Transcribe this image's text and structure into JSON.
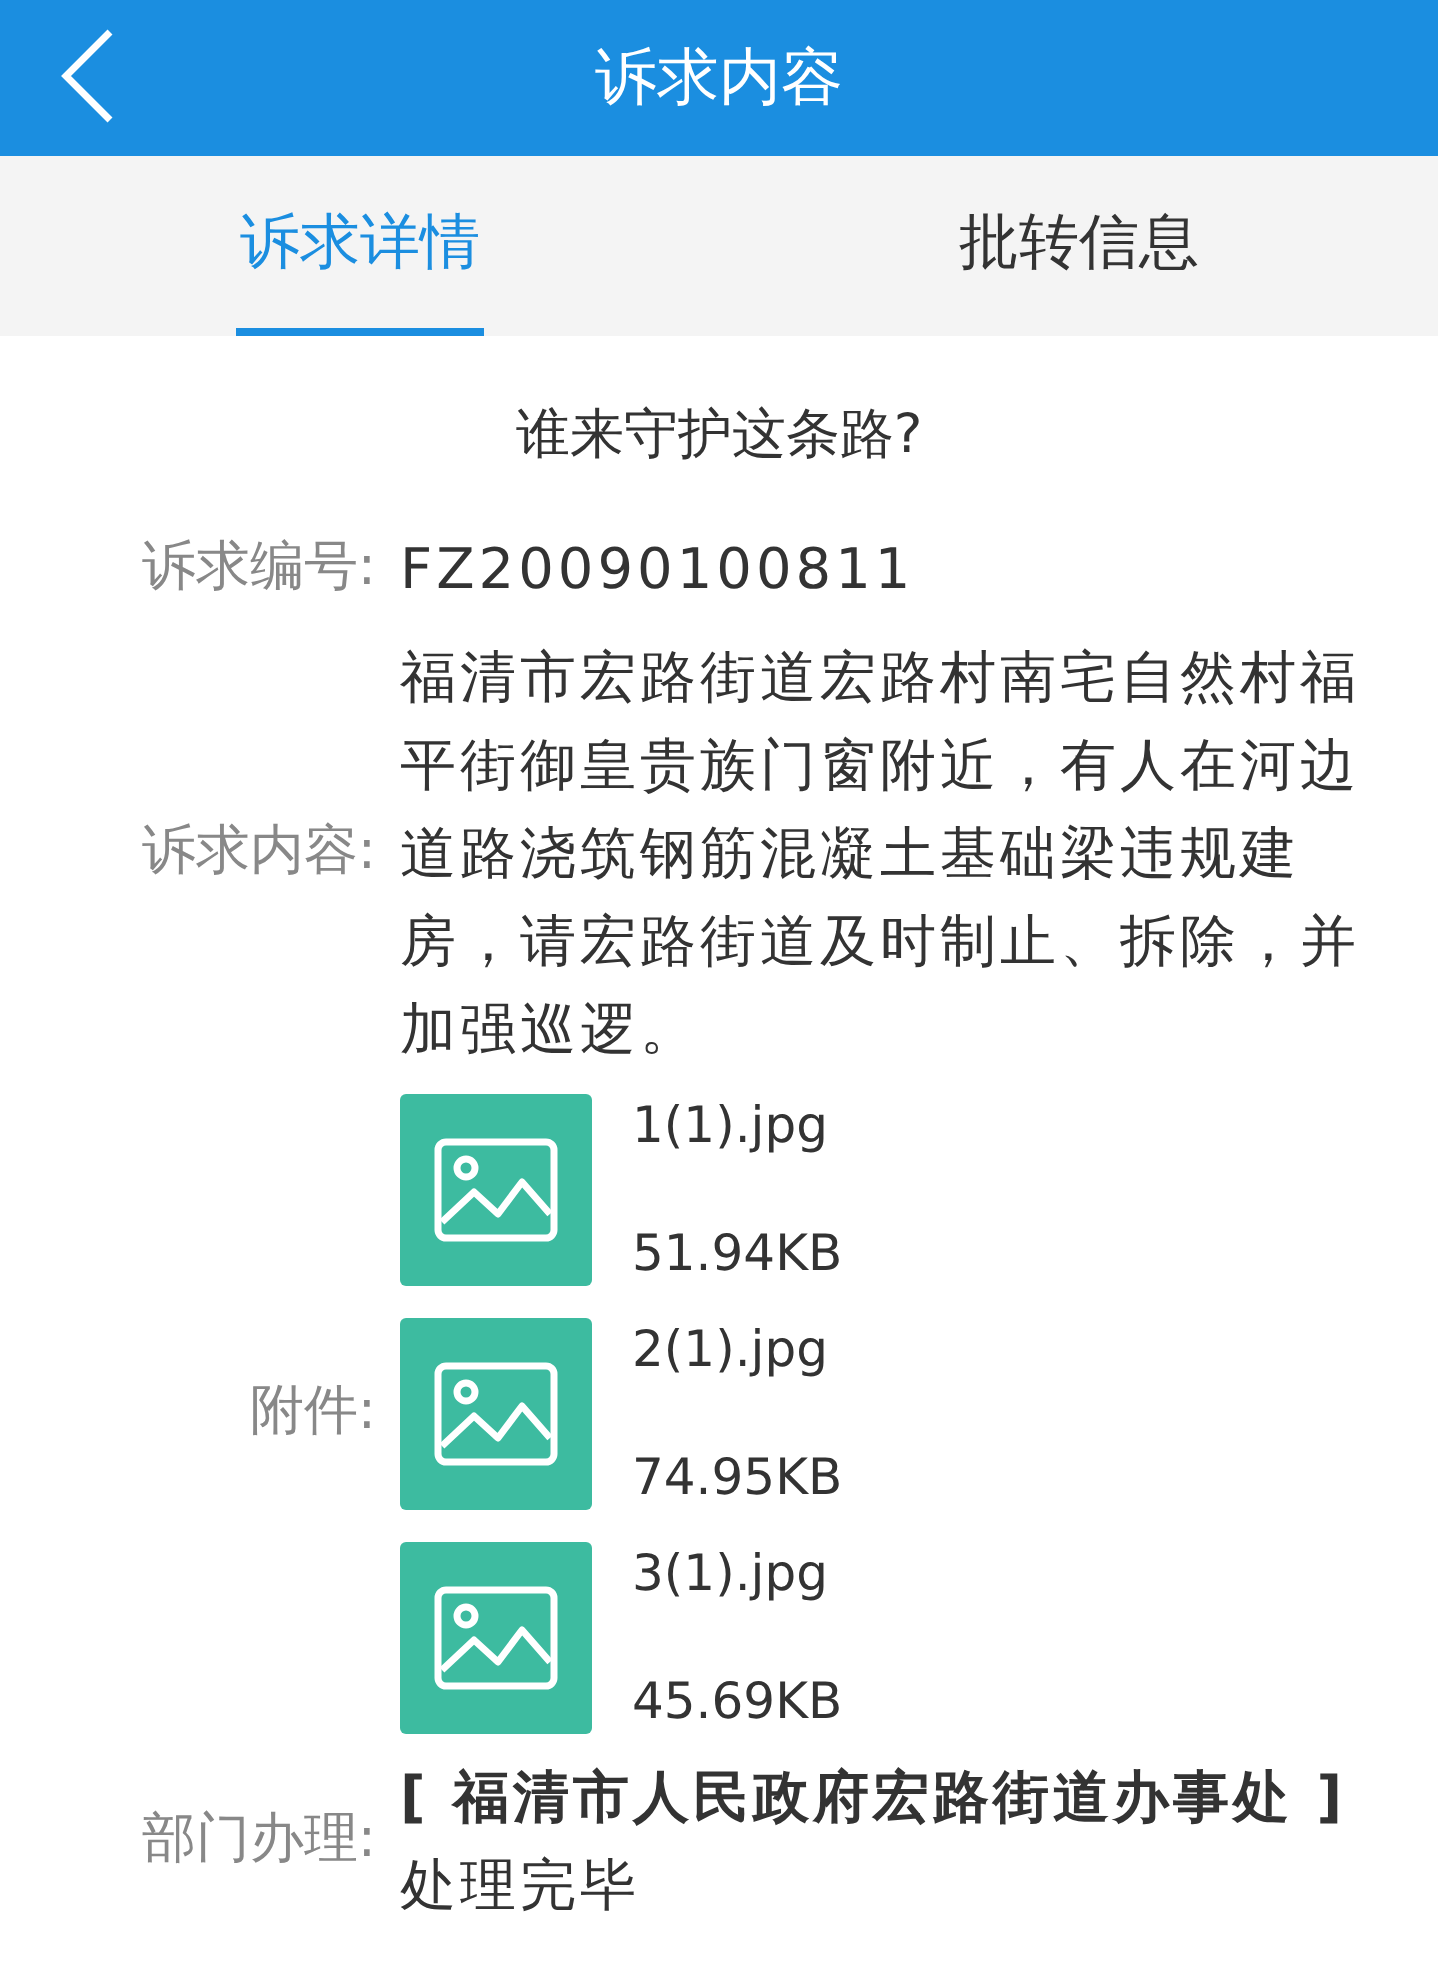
{
  "header": {
    "title": "诉求内容"
  },
  "tabs": [
    {
      "label": "诉求详情",
      "selected": true
    },
    {
      "label": "批转信息",
      "selected": false
    }
  ],
  "subject": "谁来守护这条路?",
  "fields": [
    {
      "kind": "text",
      "label": "诉求编号:",
      "value": "FZ20090100811"
    },
    {
      "kind": "text",
      "label": "诉求内容:",
      "value": "福清市宏路街道宏路村南宅自然村福平街御皇贵族门窗附近，有人在河边道路浇筑钢筋混凝土基础梁违规建房，请宏路街道及时制止、拆除，并加强巡逻。"
    },
    {
      "kind": "attachments",
      "label": "附件:",
      "files": [
        {
          "name": "1(1).jpg",
          "size": "51.94KB"
        },
        {
          "name": "2(1).jpg",
          "size": "74.95KB"
        },
        {
          "name": "3(1).jpg",
          "size": "45.69KB"
        }
      ]
    },
    {
      "kind": "rich",
      "label": "部门办理:",
      "value": "**[ 福清市人民政府宏路街道办事处 ]** 处理完毕"
    }
  ]
}
